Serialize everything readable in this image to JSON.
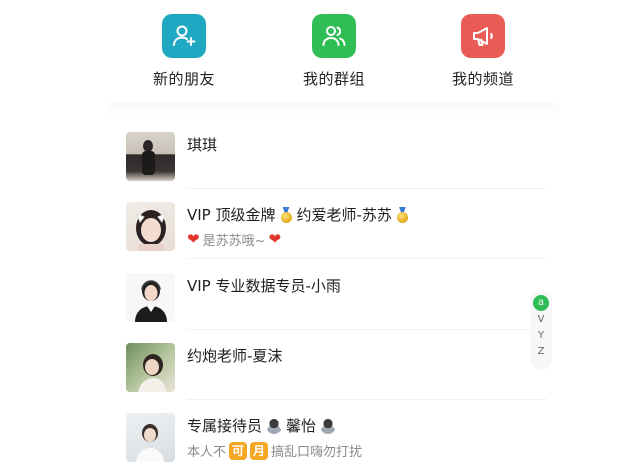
{
  "actions": [
    {
      "label": "新的朋友",
      "icon": "add-user-icon"
    },
    {
      "label": "我的群组",
      "icon": "group-icon"
    },
    {
      "label": "我的频道",
      "icon": "megaphone-icon"
    }
  ],
  "contacts": [
    {
      "name": "琪琪",
      "sub": ""
    },
    {
      "name_a": "VIP 顶级金牌",
      "name_b": "约爱老师-苏苏",
      "sub": "是苏苏哦~"
    },
    {
      "name": "VIP 专业数据专员-小雨",
      "sub": ""
    },
    {
      "name": "约炮老师-夏沫",
      "sub": ""
    },
    {
      "name_a": "专属接待员",
      "name_b": "馨怡",
      "sub_a": "本人不",
      "tag_a": "可",
      "tag_b": "月",
      "sub_b": "搞乱口嗨勿打扰"
    }
  ],
  "index": {
    "top": "a",
    "letters": [
      "V",
      "Y",
      "Z"
    ]
  }
}
